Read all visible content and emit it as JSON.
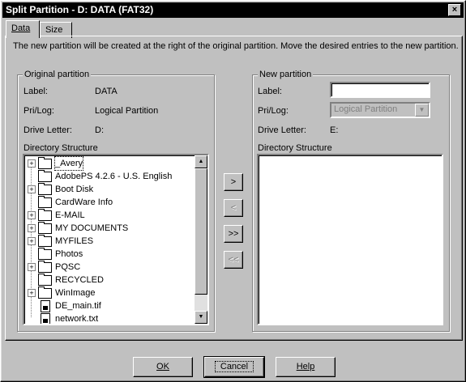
{
  "window": {
    "title": "Split Partition - D: DATA (FAT32)",
    "close_symbol": "×"
  },
  "tabs": [
    {
      "label": "Data",
      "active": true
    },
    {
      "label": "Size",
      "active": false
    }
  ],
  "intro_text": "The new partition will be created at the right of the original partition. Move the desired entries to the new partition.",
  "original": {
    "group_label": "Original partition",
    "label_caption": "Label:",
    "label_value": "DATA",
    "prilog_caption": "Pri/Log:",
    "prilog_value": "Logical Partition",
    "drive_caption": "Drive Letter:",
    "drive_value": "D:",
    "dir_caption": "Directory Structure",
    "items": [
      {
        "name": "_Avery",
        "type": "folder",
        "expandable": true,
        "selected": true
      },
      {
        "name": "AdobePS 4.2.6 - U.S. English",
        "type": "folder",
        "expandable": false
      },
      {
        "name": "Boot Disk",
        "type": "folder",
        "expandable": true
      },
      {
        "name": "CardWare Info",
        "type": "folder",
        "expandable": false
      },
      {
        "name": "E-MAIL",
        "type": "folder",
        "expandable": true
      },
      {
        "name": "MY DOCUMENTS",
        "type": "folder",
        "expandable": true
      },
      {
        "name": "MYFILES",
        "type": "folder",
        "expandable": true
      },
      {
        "name": "Photos",
        "type": "folder",
        "expandable": false
      },
      {
        "name": "PQSC",
        "type": "folder",
        "expandable": true
      },
      {
        "name": "RECYCLED",
        "type": "folder",
        "expandable": false
      },
      {
        "name": "WinImage",
        "type": "folder",
        "expandable": true
      },
      {
        "name": "DE_main.tif",
        "type": "file",
        "expandable": false
      },
      {
        "name": "network.txt",
        "type": "file",
        "expandable": false
      }
    ]
  },
  "new_partition": {
    "group_label": "New partition",
    "label_caption": "Label:",
    "label_value": "",
    "prilog_caption": "Pri/Log:",
    "prilog_value": "Logical Partition",
    "drive_caption": "Drive Letter:",
    "drive_value": "E:",
    "dir_caption": "Directory Structure"
  },
  "move_buttons": {
    "move_right": ">",
    "move_left": "<",
    "move_all_right": ">>",
    "move_all_left": "<<"
  },
  "footer": {
    "ok": "OK",
    "cancel": "Cancel",
    "help": "Help"
  }
}
